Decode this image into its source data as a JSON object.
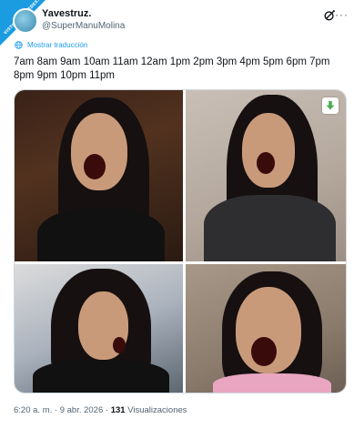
{
  "watermark": {
    "text": "VISTOENLASREDES.COM"
  },
  "author": {
    "display_name": "Yavestruz.",
    "handle": "@SuperManuMolina"
  },
  "header": {
    "grok_icon": "grok-icon",
    "more_icon": "more-icon",
    "more_glyph": "···"
  },
  "translate": {
    "label": "Mostrar traducción",
    "icon": "globe-icon"
  },
  "tweet": {
    "text": "7am 8am 9am 10am 11am 12am 1pm 2pm 3pm 4pm 5pm 6pm 7pm 8pm 9pm 10pm 11pm"
  },
  "media": {
    "count": 4,
    "download_icon": "download-icon"
  },
  "meta": {
    "time": "6:20 a. m.",
    "separator": " · ",
    "date": "9 abr. 2026",
    "views_count": "131",
    "views_label": "Visualizaciones"
  },
  "colors": {
    "accent": "#1d9bf0",
    "watermark": "#1b9be0",
    "download_green": "#4caf50",
    "text_primary": "#0f1419",
    "text_secondary": "#536471"
  }
}
